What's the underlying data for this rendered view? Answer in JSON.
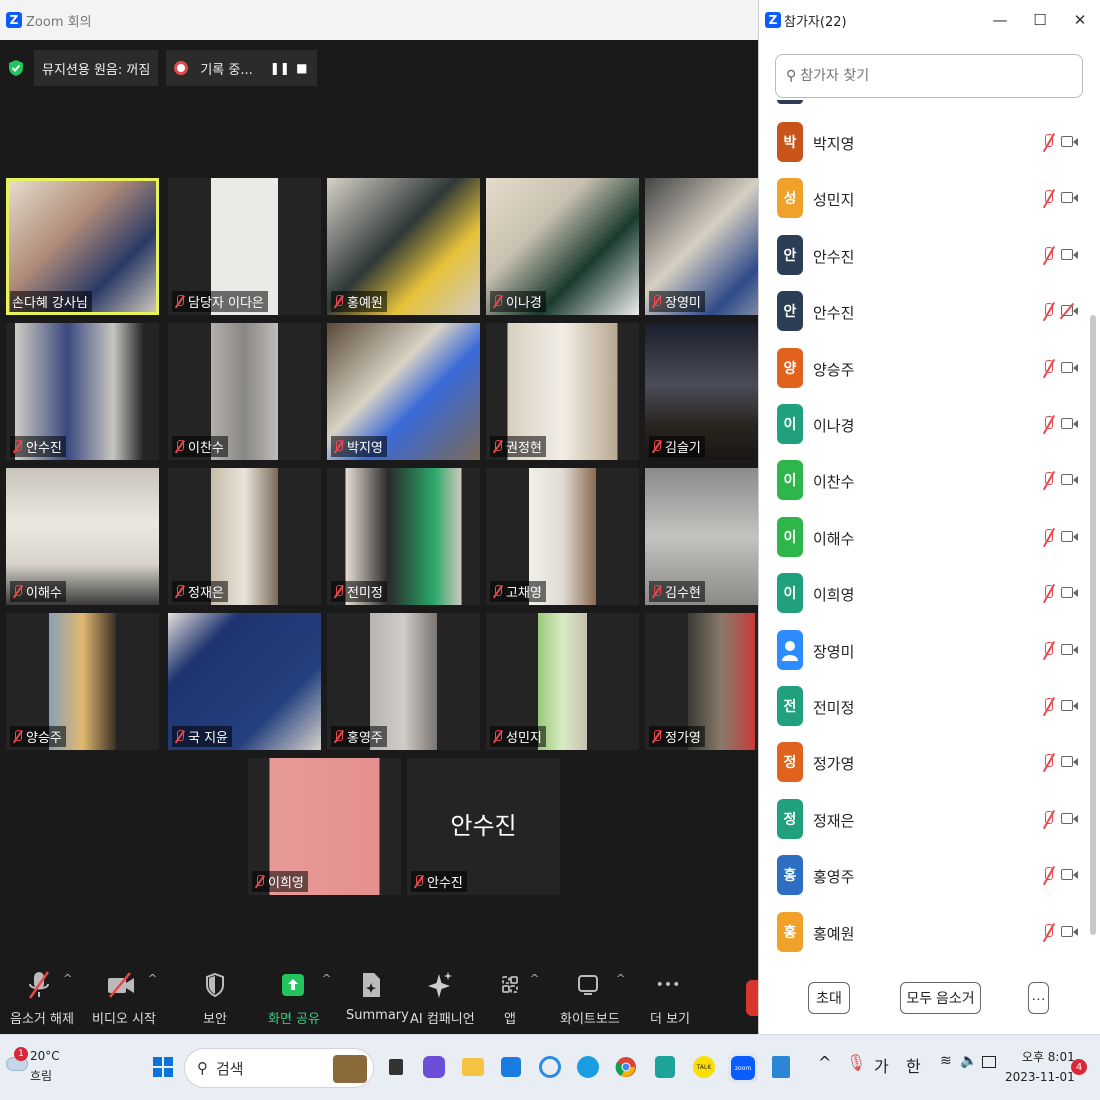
{
  "zoom": {
    "window_title": "Zoom 회의",
    "music_sound": "뮤지션용 원음: 꺼짐",
    "recording": "기록 중..."
  },
  "tiles": [
    {
      "name": "손다혜 강사님"
    },
    {
      "name": "담당자 이다은"
    },
    {
      "name": "홍예원"
    },
    {
      "name": "이나경"
    },
    {
      "name": "장영미"
    },
    {
      "name": "안수진"
    },
    {
      "name": "이찬수"
    },
    {
      "name": "박지영"
    },
    {
      "name": "권정현"
    },
    {
      "name": "김슬기"
    },
    {
      "name": "이해수"
    },
    {
      "name": "정재은"
    },
    {
      "name": "전미정"
    },
    {
      "name": "고채영"
    },
    {
      "name": "김수현"
    },
    {
      "name": "양승주"
    },
    {
      "name": "국 지윤"
    },
    {
      "name": "홍영주"
    },
    {
      "name": "성민지"
    },
    {
      "name": "정가영"
    },
    {
      "name": "이희영"
    },
    {
      "name": "안수진",
      "big": "안수진"
    }
  ],
  "toolbar": {
    "unmute": "음소거 해제",
    "start_video": "비디오 시작",
    "security": "보안",
    "share_screen": "화면 공유",
    "summary": "Summary",
    "ai_companion": "AI 컴패니언",
    "apps": "앱",
    "whiteboard": "화이트보드",
    "more": "더 보기",
    "more_icon": "•••"
  },
  "panel": {
    "title": "참가자(22)",
    "search_placeholder": "참가자 찾기",
    "participants": [
      {
        "initial": "박",
        "name": "박지영",
        "color": "#c8541a",
        "cam_off": false
      },
      {
        "initial": "성",
        "name": "성민지",
        "color": "#f0a12a",
        "cam_off": false
      },
      {
        "initial": "안",
        "name": "안수진",
        "color": "#2c3e55",
        "cam_off": false
      },
      {
        "initial": "안",
        "name": "안수진",
        "color": "#2c3e55",
        "cam_off": true
      },
      {
        "initial": "양",
        "name": "양승주",
        "color": "#e0621c",
        "cam_off": false
      },
      {
        "initial": "이",
        "name": "이나경",
        "color": "#20a07c",
        "cam_off": false
      },
      {
        "initial": "이",
        "name": "이찬수",
        "color": "#2fb64a",
        "cam_off": false
      },
      {
        "initial": "이",
        "name": "이해수",
        "color": "#2fb64a",
        "cam_off": false
      },
      {
        "initial": "이",
        "name": "이희영",
        "color": "#20a07c",
        "cam_off": false
      },
      {
        "initial": "",
        "name": "장영미",
        "color": "#2d8cff",
        "cam_off": false
      },
      {
        "initial": "전",
        "name": "전미정",
        "color": "#20a07c",
        "cam_off": false
      },
      {
        "initial": "정",
        "name": "정가영",
        "color": "#e0621c",
        "cam_off": false
      },
      {
        "initial": "정",
        "name": "정재은",
        "color": "#20a07c",
        "cam_off": false
      },
      {
        "initial": "홍",
        "name": "홍영주",
        "color": "#2e6fc4",
        "cam_off": false
      },
      {
        "initial": "홍",
        "name": "홍예원",
        "color": "#f0a12a",
        "cam_off": false
      }
    ],
    "invite": "초대",
    "mute_all": "모두 음소거",
    "more": "···"
  },
  "taskbar": {
    "weather_temp": "20°C",
    "weather_desc": "흐림",
    "weather_badge": "1",
    "search": "검색",
    "ime_ga": "가",
    "ime_han": "한",
    "time": "오후 8:01",
    "date": "2023-11-01",
    "notifications": "4"
  }
}
